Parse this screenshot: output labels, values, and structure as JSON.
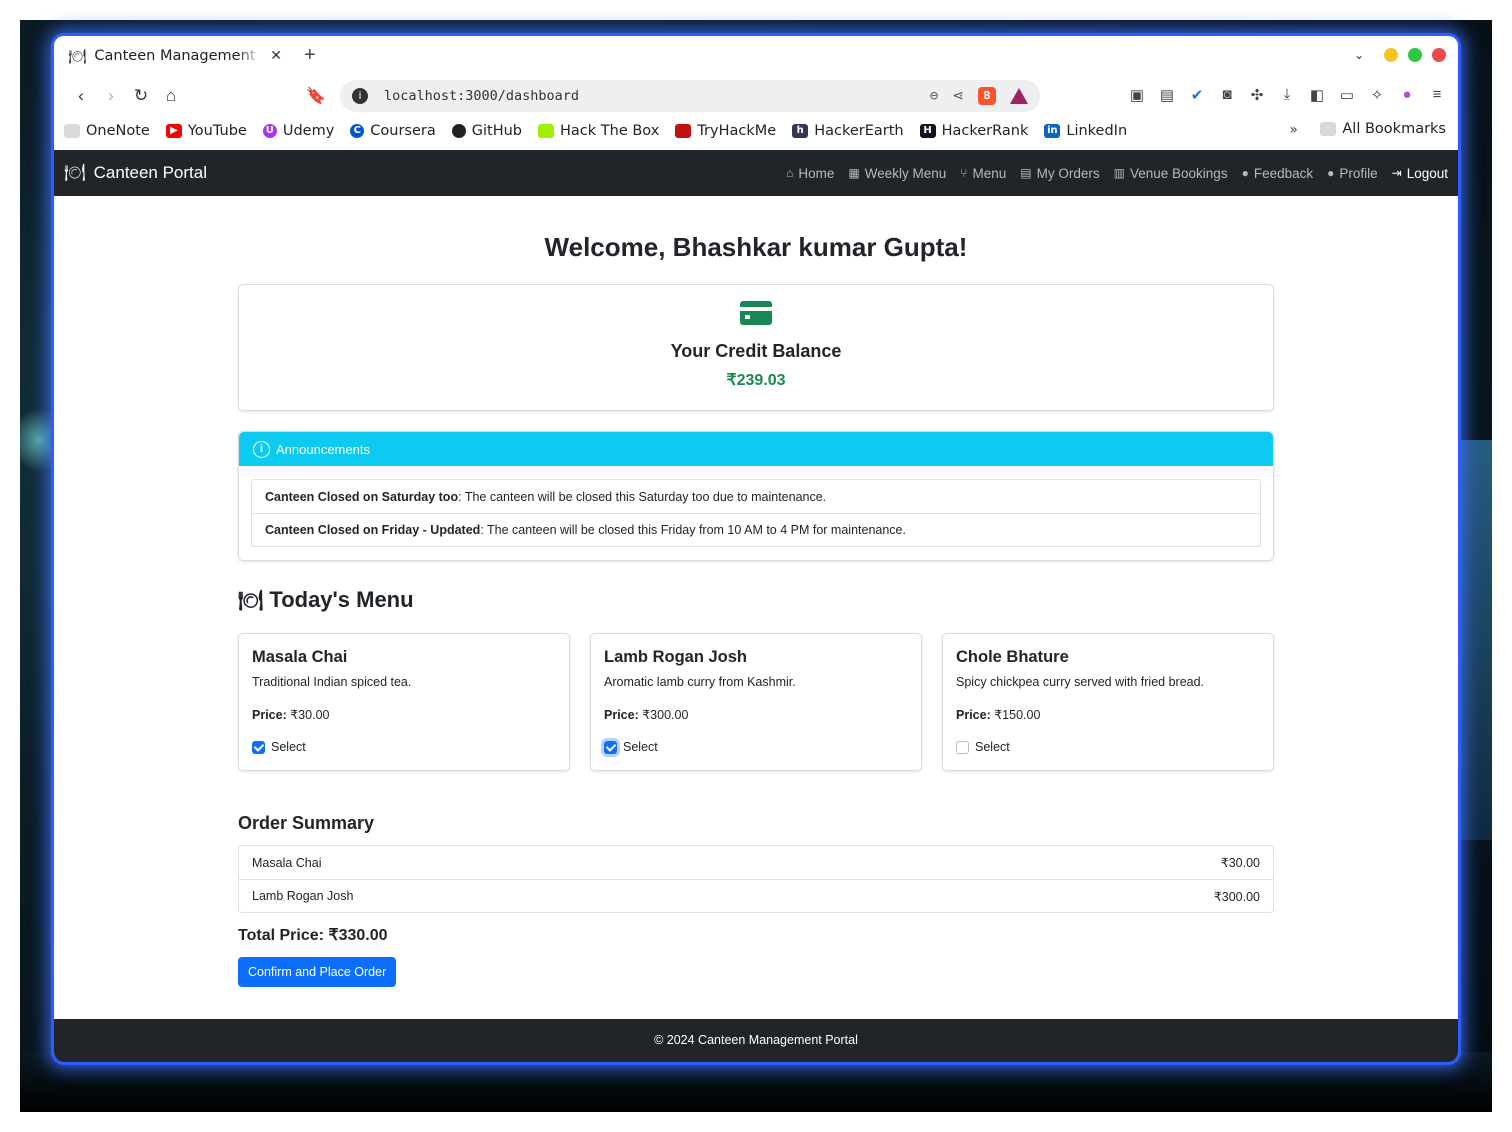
{
  "browser": {
    "tab_title": "Canteen Management P",
    "url": "localhost:3000/dashboard",
    "bookmarks": [
      {
        "label": "OneNote",
        "icon": "folder-icon",
        "color": "#d9d9d9"
      },
      {
        "label": "YouTube",
        "icon": "youtube-icon",
        "color": "#ff0000"
      },
      {
        "label": "Udemy",
        "icon": "udemy-icon",
        "color": "#a435f0"
      },
      {
        "label": "Coursera",
        "icon": "coursera-icon",
        "color": "#0056d2"
      },
      {
        "label": "GitHub",
        "icon": "github-icon",
        "color": "#222222"
      },
      {
        "label": "Hack The Box",
        "icon": "hackthebox-icon",
        "color": "#9fef00"
      },
      {
        "label": "TryHackMe",
        "icon": "tryhackme-icon",
        "color": "#c11111"
      },
      {
        "label": "HackerEarth",
        "icon": "hackerearth-icon",
        "color": "#323754"
      },
      {
        "label": "HackerRank",
        "icon": "hackerrank-icon",
        "color": "#0e141e"
      },
      {
        "label": "LinkedIn",
        "icon": "linkedin-icon",
        "color": "#0a66c2"
      }
    ],
    "all_bookmarks": "All Bookmarks"
  },
  "nav": {
    "brand": "Canteen Portal",
    "links": [
      {
        "label": "Home",
        "icon": "home-icon"
      },
      {
        "label": "Weekly Menu",
        "icon": "calendar-icon"
      },
      {
        "label": "Menu",
        "icon": "utensils-icon"
      },
      {
        "label": "My Orders",
        "icon": "list-icon"
      },
      {
        "label": "Venue Bookings",
        "icon": "building-icon"
      },
      {
        "label": "Feedback",
        "icon": "comment-icon"
      },
      {
        "label": "Profile",
        "icon": "user-icon"
      },
      {
        "label": "Logout",
        "icon": "logout-icon"
      }
    ]
  },
  "welcome": {
    "prefix": "Welcome, ",
    "name": "Bhashkar kumar Gupta",
    "suffix": "!"
  },
  "credit": {
    "title": "Your Credit Balance",
    "amount": "₹239.03"
  },
  "announcements": {
    "heading": "Announcements",
    "items": [
      {
        "title": "Canteen Closed on Saturday too",
        "text": ": The canteen will be closed this Saturday too due to maintenance."
      },
      {
        "title": "Canteen Closed on Friday - Updated",
        "text": ": The canteen will be closed this Friday from 10 AM to 4 PM for maintenance."
      }
    ]
  },
  "menu": {
    "heading": "Today's Menu",
    "price_label": "Price:",
    "select_label": "Select",
    "items": [
      {
        "name": "Masala Chai",
        "description": "Traditional Indian spiced tea.",
        "price": "₹30.00",
        "selected": true
      },
      {
        "name": "Lamb Rogan Josh",
        "description": "Aromatic lamb curry from Kashmir.",
        "price": "₹300.00",
        "selected": true
      },
      {
        "name": "Chole Bhature",
        "description": "Spicy chickpea curry served with fried bread.",
        "price": "₹150.00",
        "selected": false
      }
    ]
  },
  "summary": {
    "heading": "Order Summary",
    "items": [
      {
        "name": "Masala Chai",
        "price": "₹30.00"
      },
      {
        "name": "Lamb Rogan Josh",
        "price": "₹300.00"
      }
    ],
    "total": "Total Price: ₹330.00",
    "button": "Confirm and Place Order"
  },
  "footer": "© 2024 Canteen Management Portal",
  "colors": {
    "navbar": "#212529",
    "success": "#198754",
    "info": "#0dcaf0",
    "primary": "#0d6efd"
  }
}
